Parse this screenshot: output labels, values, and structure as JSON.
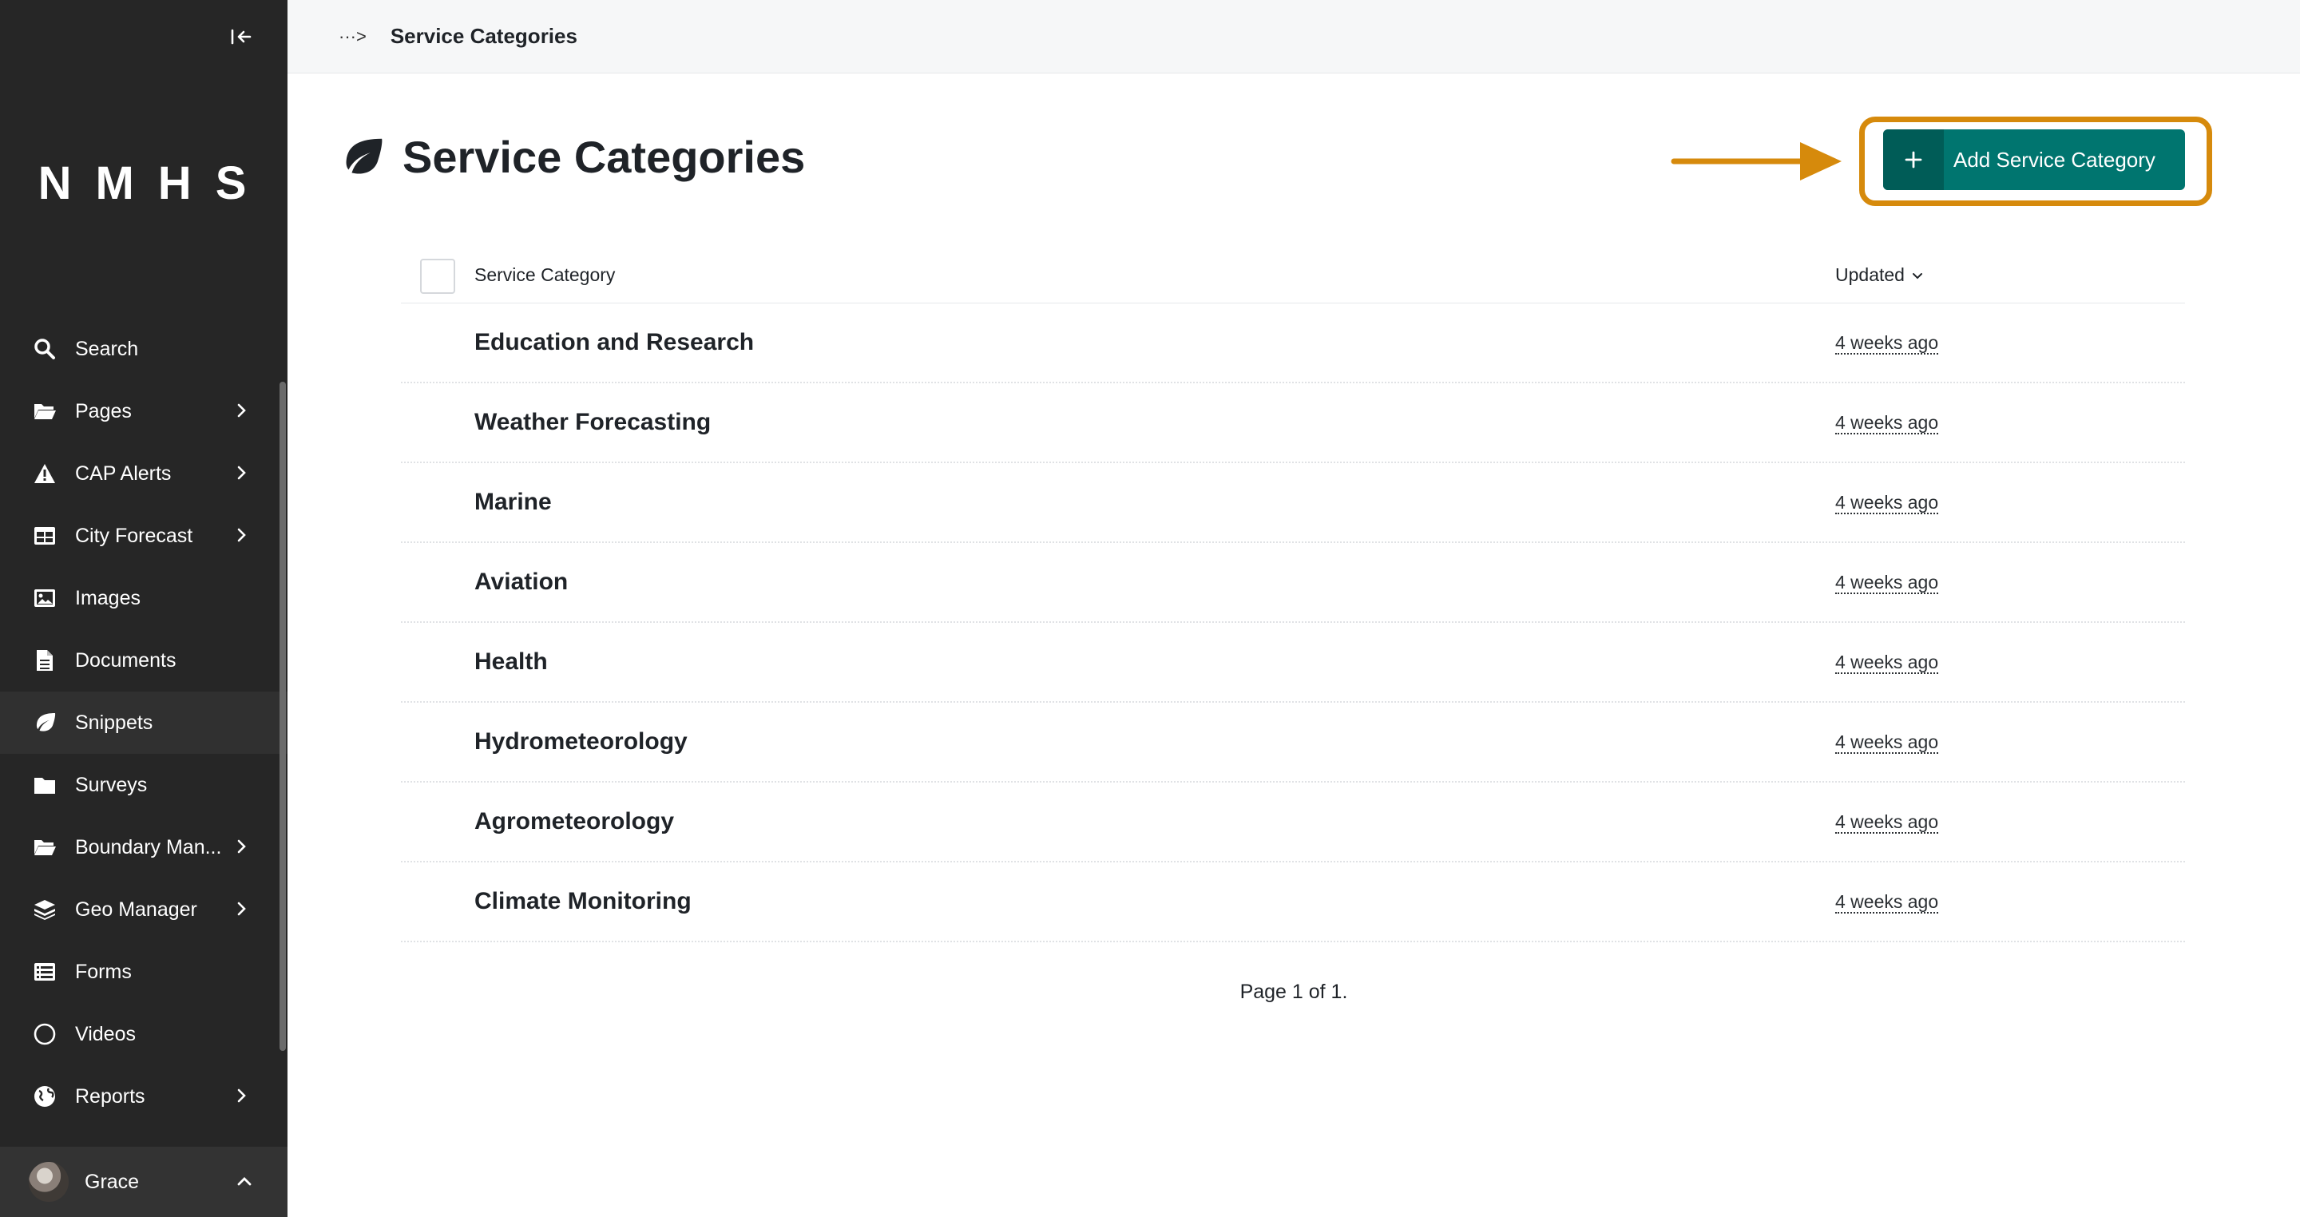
{
  "sidebar": {
    "logo": "NMHS",
    "items": [
      {
        "label": "Search",
        "icon": "search-icon",
        "has_submenu": false
      },
      {
        "label": "Pages",
        "icon": "folder-open-icon",
        "has_submenu": true
      },
      {
        "label": "CAP Alerts",
        "icon": "warning-icon",
        "has_submenu": true
      },
      {
        "label": "City Forecast",
        "icon": "table-icon",
        "has_submenu": true
      },
      {
        "label": "Images",
        "icon": "image-icon",
        "has_submenu": false
      },
      {
        "label": "Documents",
        "icon": "document-icon",
        "has_submenu": false
      },
      {
        "label": "Snippets",
        "icon": "leaf-icon",
        "has_submenu": false,
        "active": true
      },
      {
        "label": "Surveys",
        "icon": "folder-icon",
        "has_submenu": false
      },
      {
        "label": "Boundary Man...",
        "icon": "folder-open-icon",
        "has_submenu": true
      },
      {
        "label": "Geo Manager",
        "icon": "layers-icon",
        "has_submenu": true
      },
      {
        "label": "Forms",
        "icon": "list-icon",
        "has_submenu": false
      },
      {
        "label": "Videos",
        "icon": "circle-icon",
        "has_submenu": false
      },
      {
        "label": "Reports",
        "icon": "globe-icon",
        "has_submenu": true
      }
    ],
    "account": {
      "name": "Grace"
    }
  },
  "breadcrumb": {
    "toggle": "···>",
    "current": "Service Categories"
  },
  "header": {
    "title": "Service Categories",
    "icon": "leaf-icon",
    "add_button_label": "Add Service Category"
  },
  "listing": {
    "columns": {
      "title": "Service Category",
      "updated": "Updated"
    },
    "rows": [
      {
        "title": "Education and Research",
        "updated": "4 weeks ago"
      },
      {
        "title": "Weather Forecasting",
        "updated": "4 weeks ago"
      },
      {
        "title": "Marine",
        "updated": "4 weeks ago"
      },
      {
        "title": "Aviation",
        "updated": "4 weeks ago"
      },
      {
        "title": "Health",
        "updated": "4 weeks ago"
      },
      {
        "title": "Hydrometeorology",
        "updated": "4 weeks ago"
      },
      {
        "title": "Agrometeorology",
        "updated": "4 weeks ago"
      },
      {
        "title": "Climate Monitoring",
        "updated": "4 weeks ago"
      }
    ]
  },
  "pagination": {
    "text": "Page 1 of 1."
  },
  "colors": {
    "sidebar_bg": "#262626",
    "accent": "#00756f",
    "highlight": "#d68a0c"
  }
}
